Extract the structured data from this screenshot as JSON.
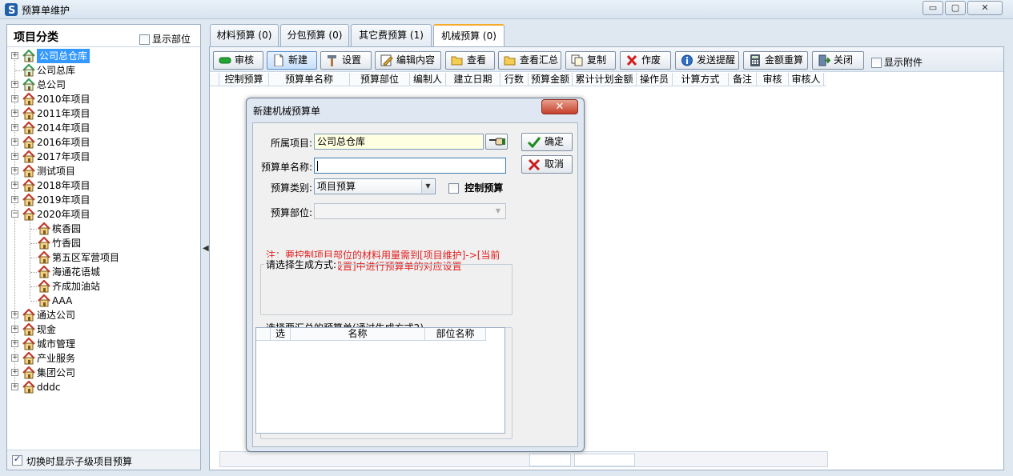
{
  "window": {
    "title": "预算单维护",
    "buttons": {
      "minimize": "▭",
      "maximize": "▢",
      "close": "✕"
    }
  },
  "left_panel": {
    "title": "项目分类",
    "show_dept_label": "显示部位",
    "tree": [
      {
        "label": "公司总仓库",
        "selected": true
      },
      {
        "label": "公司总库"
      },
      {
        "label": "总公司"
      },
      {
        "label": "2010年项目"
      },
      {
        "label": "2011年项目"
      },
      {
        "label": "2014年项目"
      },
      {
        "label": "2016年项目"
      },
      {
        "label": "2017年项目"
      },
      {
        "label": "测试项目"
      },
      {
        "label": "2018年项目"
      },
      {
        "label": "2019年项目"
      },
      {
        "label": "2020年项目"
      },
      {
        "label": "槟香园"
      },
      {
        "label": "竹香园"
      },
      {
        "label": "第五区军营项目"
      },
      {
        "label": "海通花语城"
      },
      {
        "label": "齐成加油站"
      },
      {
        "label": "AAA"
      },
      {
        "label": "通达公司"
      },
      {
        "label": "现金"
      },
      {
        "label": "城市管理"
      },
      {
        "label": "产业服务"
      },
      {
        "label": "集团公司"
      },
      {
        "label": "dddc"
      }
    ],
    "footer_checkbox_label": "切换时显示子级项目预算"
  },
  "tabs": [
    {
      "label": "材料预算 (0)"
    },
    {
      "label": "分包预算 (0)"
    },
    {
      "label": "其它费预算 (1)"
    },
    {
      "label": "机械预算 (0)",
      "active": true
    }
  ],
  "toolbar": {
    "review": "审核",
    "new": "新建",
    "settings": "设置",
    "edit_content": "编辑内容",
    "view": "查看",
    "view_summary": "查看汇总",
    "copy": "复制",
    "void": "作废",
    "send_reminder": "发送提醒",
    "recalc_amount": "金额重算",
    "close": "关闭",
    "show_attachments": "显示附件"
  },
  "grid_columns": [
    "控制预算",
    "预算单名称",
    "预算部位",
    "编制人",
    "建立日期",
    "行数",
    "预算金额",
    "累计计划金额",
    "操作员",
    "计算方式",
    "备注",
    "审核",
    "审核人"
  ],
  "dialog": {
    "title": "新建机械预算单",
    "project_label": "所属项目:",
    "project_value": "公司总仓库",
    "name_label": "预算单名称:",
    "name_value": "",
    "type_label": "预算类别:",
    "type_value": "项目预算",
    "control_budget_label": "控制预算",
    "dept_label": "预算部位:",
    "dept_value": "",
    "note_line1": "注：要控制项目部位的材料用量需到[项目维护]->[当前",
    "note_line2": "项目部位及进度设置]中进行预算单的对应设置",
    "gen_mode_label": "请选择生成方式:",
    "summary_label": "选择要汇总的预算单(通过生成方式2)",
    "summary_columns": [
      "选",
      "名称",
      "部位名称"
    ],
    "ok": "确定",
    "cancel": "取消",
    "close_glyph": "✕"
  }
}
